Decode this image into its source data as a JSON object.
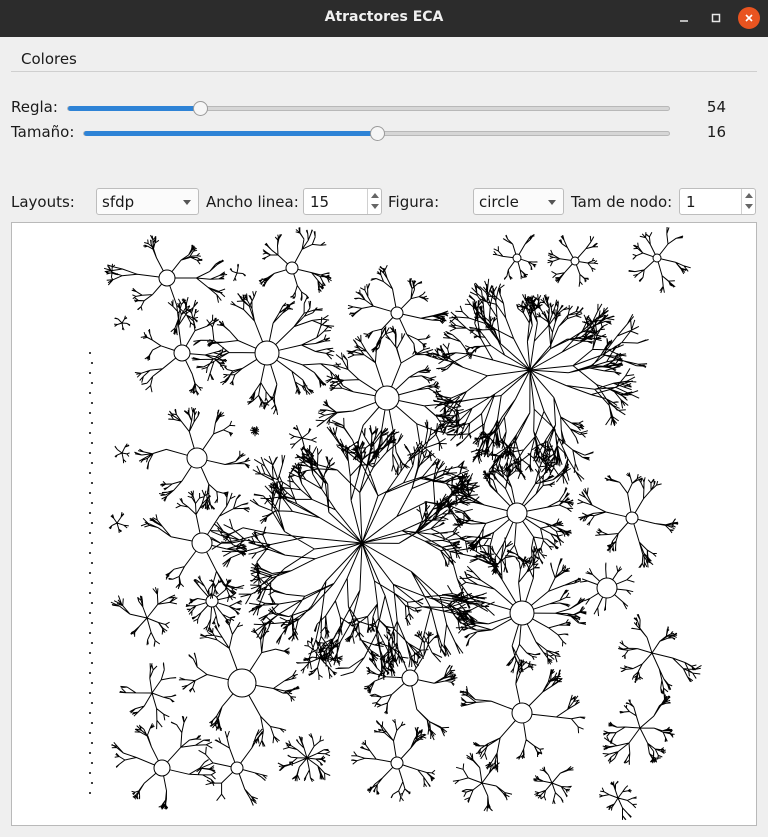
{
  "window": {
    "title": "Atractores ECA"
  },
  "window_controls": {
    "minimize_icon": "minimize-icon",
    "maximize_icon": "maximize-icon",
    "close_icon": "close-icon",
    "close_color": "#e95420"
  },
  "menu": {
    "items": [
      {
        "label": "Colores"
      }
    ]
  },
  "sliders": {
    "regla": {
      "label": "Regla:",
      "value": "54",
      "fraction": 0.22
    },
    "tamano": {
      "label": "Tamaño:",
      "value": "16",
      "fraction": 0.5
    }
  },
  "controls": {
    "layouts": {
      "label": "Layouts:",
      "selected": "sfdp"
    },
    "ancho_linea": {
      "label": "Ancho linea:",
      "value": "15"
    },
    "figura": {
      "label": "Figura:",
      "selected": "circle"
    },
    "tam_nodo": {
      "label": "Tam de nodo:",
      "value": "1"
    }
  },
  "colors": {
    "accent": "#2e83d6",
    "title_bg": "#2c2c2c",
    "graph_ink": "#000000",
    "canvas_bg": "#ffffff"
  }
}
